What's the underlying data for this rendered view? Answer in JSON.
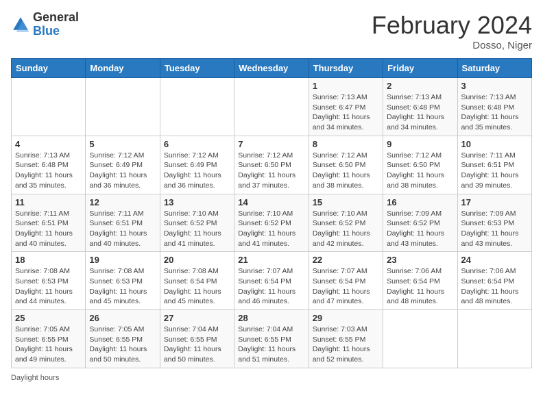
{
  "header": {
    "logo_general": "General",
    "logo_blue": "Blue",
    "main_title": "February 2024",
    "subtitle": "Dosso, Niger"
  },
  "calendar": {
    "days_of_week": [
      "Sunday",
      "Monday",
      "Tuesday",
      "Wednesday",
      "Thursday",
      "Friday",
      "Saturday"
    ],
    "weeks": [
      [
        {
          "day": "",
          "info": ""
        },
        {
          "day": "",
          "info": ""
        },
        {
          "day": "",
          "info": ""
        },
        {
          "day": "",
          "info": ""
        },
        {
          "day": "1",
          "info": "Sunrise: 7:13 AM\nSunset: 6:47 PM\nDaylight: 11 hours and 34 minutes."
        },
        {
          "day": "2",
          "info": "Sunrise: 7:13 AM\nSunset: 6:48 PM\nDaylight: 11 hours and 34 minutes."
        },
        {
          "day": "3",
          "info": "Sunrise: 7:13 AM\nSunset: 6:48 PM\nDaylight: 11 hours and 35 minutes."
        }
      ],
      [
        {
          "day": "4",
          "info": "Sunrise: 7:13 AM\nSunset: 6:48 PM\nDaylight: 11 hours and 35 minutes."
        },
        {
          "day": "5",
          "info": "Sunrise: 7:12 AM\nSunset: 6:49 PM\nDaylight: 11 hours and 36 minutes."
        },
        {
          "day": "6",
          "info": "Sunrise: 7:12 AM\nSunset: 6:49 PM\nDaylight: 11 hours and 36 minutes."
        },
        {
          "day": "7",
          "info": "Sunrise: 7:12 AM\nSunset: 6:50 PM\nDaylight: 11 hours and 37 minutes."
        },
        {
          "day": "8",
          "info": "Sunrise: 7:12 AM\nSunset: 6:50 PM\nDaylight: 11 hours and 38 minutes."
        },
        {
          "day": "9",
          "info": "Sunrise: 7:12 AM\nSunset: 6:50 PM\nDaylight: 11 hours and 38 minutes."
        },
        {
          "day": "10",
          "info": "Sunrise: 7:11 AM\nSunset: 6:51 PM\nDaylight: 11 hours and 39 minutes."
        }
      ],
      [
        {
          "day": "11",
          "info": "Sunrise: 7:11 AM\nSunset: 6:51 PM\nDaylight: 11 hours and 40 minutes."
        },
        {
          "day": "12",
          "info": "Sunrise: 7:11 AM\nSunset: 6:51 PM\nDaylight: 11 hours and 40 minutes."
        },
        {
          "day": "13",
          "info": "Sunrise: 7:10 AM\nSunset: 6:52 PM\nDaylight: 11 hours and 41 minutes."
        },
        {
          "day": "14",
          "info": "Sunrise: 7:10 AM\nSunset: 6:52 PM\nDaylight: 11 hours and 41 minutes."
        },
        {
          "day": "15",
          "info": "Sunrise: 7:10 AM\nSunset: 6:52 PM\nDaylight: 11 hours and 42 minutes."
        },
        {
          "day": "16",
          "info": "Sunrise: 7:09 AM\nSunset: 6:52 PM\nDaylight: 11 hours and 43 minutes."
        },
        {
          "day": "17",
          "info": "Sunrise: 7:09 AM\nSunset: 6:53 PM\nDaylight: 11 hours and 43 minutes."
        }
      ],
      [
        {
          "day": "18",
          "info": "Sunrise: 7:08 AM\nSunset: 6:53 PM\nDaylight: 11 hours and 44 minutes."
        },
        {
          "day": "19",
          "info": "Sunrise: 7:08 AM\nSunset: 6:53 PM\nDaylight: 11 hours and 45 minutes."
        },
        {
          "day": "20",
          "info": "Sunrise: 7:08 AM\nSunset: 6:54 PM\nDaylight: 11 hours and 45 minutes."
        },
        {
          "day": "21",
          "info": "Sunrise: 7:07 AM\nSunset: 6:54 PM\nDaylight: 11 hours and 46 minutes."
        },
        {
          "day": "22",
          "info": "Sunrise: 7:07 AM\nSunset: 6:54 PM\nDaylight: 11 hours and 47 minutes."
        },
        {
          "day": "23",
          "info": "Sunrise: 7:06 AM\nSunset: 6:54 PM\nDaylight: 11 hours and 48 minutes."
        },
        {
          "day": "24",
          "info": "Sunrise: 7:06 AM\nSunset: 6:54 PM\nDaylight: 11 hours and 48 minutes."
        }
      ],
      [
        {
          "day": "25",
          "info": "Sunrise: 7:05 AM\nSunset: 6:55 PM\nDaylight: 11 hours and 49 minutes."
        },
        {
          "day": "26",
          "info": "Sunrise: 7:05 AM\nSunset: 6:55 PM\nDaylight: 11 hours and 50 minutes."
        },
        {
          "day": "27",
          "info": "Sunrise: 7:04 AM\nSunset: 6:55 PM\nDaylight: 11 hours and 50 minutes."
        },
        {
          "day": "28",
          "info": "Sunrise: 7:04 AM\nSunset: 6:55 PM\nDaylight: 11 hours and 51 minutes."
        },
        {
          "day": "29",
          "info": "Sunrise: 7:03 AM\nSunset: 6:55 PM\nDaylight: 11 hours and 52 minutes."
        },
        {
          "day": "",
          "info": ""
        },
        {
          "day": "",
          "info": ""
        }
      ]
    ]
  },
  "footer": {
    "daylight_label": "Daylight hours"
  }
}
